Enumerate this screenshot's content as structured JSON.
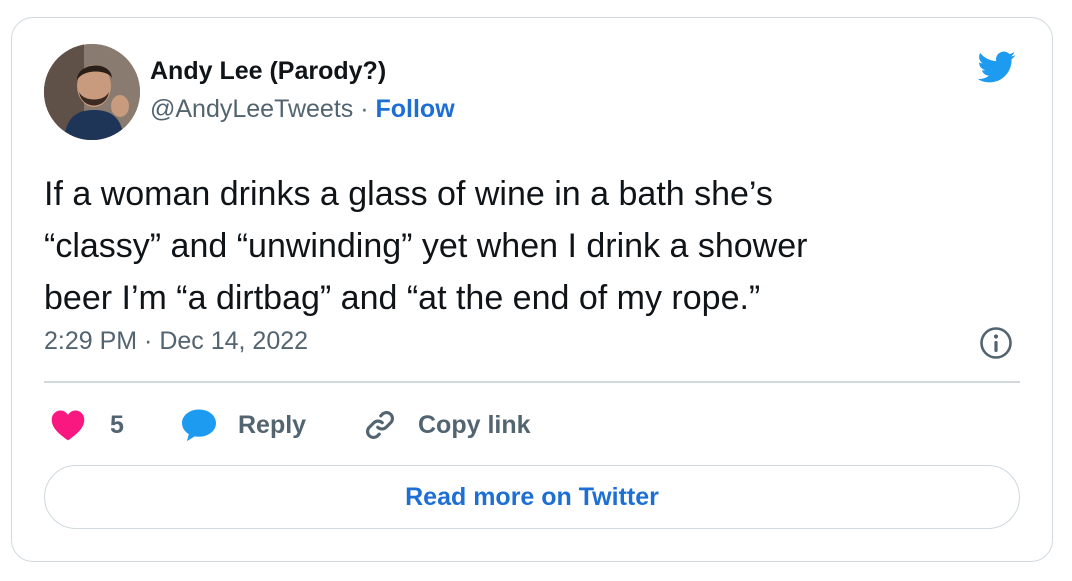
{
  "author": {
    "display_name": "Andy Lee (Parody?)",
    "handle": "@AndyLeeTweets",
    "separator": " · ",
    "follow_label": "Follow"
  },
  "tweet": {
    "text": "If a woman drinks a glass of wine in a bath she’s\n“classy” and “unwinding” yet when I drink a shower\nbeer I’m “a dirtbag” and “at the end of my rope.”",
    "timestamp": "2:29 PM · Dec 14, 2022"
  },
  "actions": {
    "like_count": "5",
    "reply_label": "Reply",
    "copy_link_label": "Copy link"
  },
  "read_more_label": "Read more on Twitter",
  "colors": {
    "like": "#f91880",
    "reply": "#1d9bf0",
    "link": "#1d6fd6",
    "muted": "#536471",
    "border": "#cfd9de",
    "twitter_bird": "#1d9bf0"
  },
  "icons": {
    "brand": "twitter-bird-icon",
    "info": "info-icon",
    "like": "heart-icon",
    "reply": "speech-bubble-icon",
    "copy": "link-icon"
  }
}
